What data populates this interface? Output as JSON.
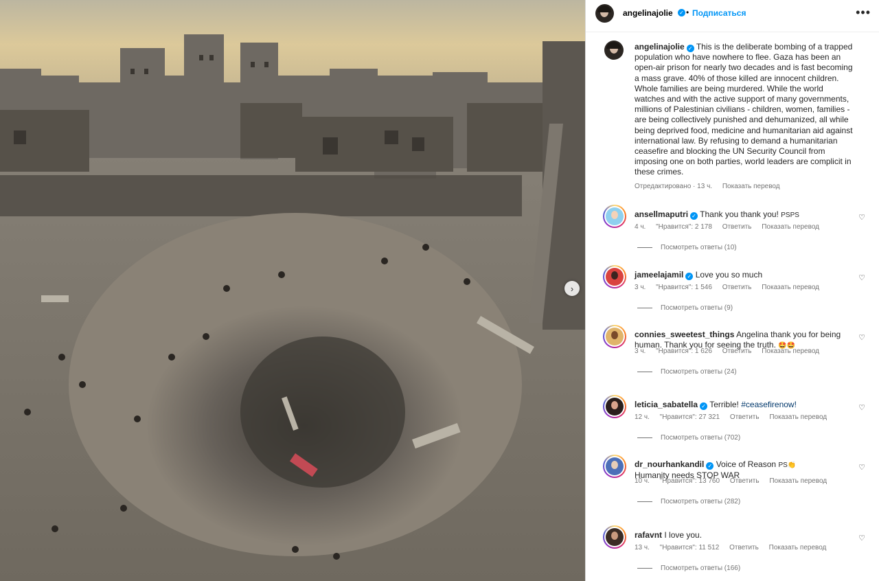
{
  "post": {
    "author": "angelinajolie",
    "follow_label": "Подписаться",
    "more_label": "•••",
    "caption": "This is the deliberate bombing of a trapped population who have nowhere to flee. Gaza has been an open-air prison for nearly two decades and is fast becoming a mass grave. 40% of those killed are innocent children. Whole families are being murdered. While the world watches and with the active support of many governments, millions of Palestinian civilians - children, women, families - are being collectively punished and dehumanized, all while being deprived food, medicine and humanitarian aid against international law. By refusing to demand a humanitarian ceasefire and blocking the UN Security Council from imposing one on both parties, world leaders are complicit in these crimes.",
    "edited": "Отредактировано · 13 ч.",
    "translate": "Показать перевод"
  },
  "labels": {
    "reply": "Ответить",
    "translate": "Показать перевод"
  },
  "comments": [
    {
      "user": "ansellmaputri",
      "verified": true,
      "text": "Thank you thank you!",
      "emoji": "PSPS",
      "time": "4 ч.",
      "likes": "\"Нравится\": 2 178",
      "replies": "Посмотреть ответы (10)"
    },
    {
      "user": "jameelajamil",
      "verified": true,
      "text": "Love you so much",
      "emoji": "",
      "time": "3 ч.",
      "likes": "\"Нравится\": 1 546",
      "replies": "Посмотреть ответы (9)"
    },
    {
      "user": "connies_sweetest_things",
      "verified": false,
      "text": "Angelina thank you for being human. Thank you for seeing the truth.",
      "emoji": "🤩🤩",
      "time": "3 ч.",
      "likes": "\"Нравится\": 1 626",
      "replies": "Посмотреть ответы (24)"
    },
    {
      "user": "leticia_sabatella",
      "verified": true,
      "text": "Terrible!",
      "hashtag": "#ceasefirenow!",
      "emoji": "",
      "time": "12 ч.",
      "likes": "\"Нравится\": 27 321",
      "replies": "Посмотреть ответы (702)"
    },
    {
      "user": "dr_nourhankandil",
      "verified": true,
      "text": "Voice of Reason",
      "emoji": "PS👏",
      "line2": "Humanity needs STOP WAR",
      "time": "10 ч.",
      "likes": "\"Нравится\": 13 760",
      "replies": "Посмотреть ответы (282)"
    },
    {
      "user": "rafavnt",
      "verified": false,
      "text": "I love you.",
      "emoji": "",
      "time": "13 ч.",
      "likes": "\"Нравится\": 11 512",
      "replies": "Посмотреть ответы (166)"
    }
  ]
}
